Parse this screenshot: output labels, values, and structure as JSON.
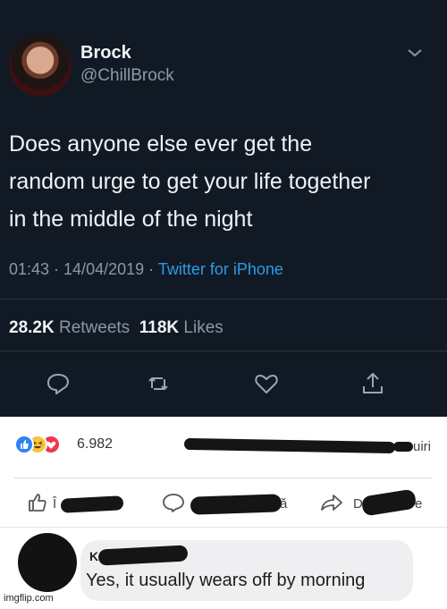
{
  "tweet": {
    "name": "Brock",
    "handle": "@ChillBrock",
    "text_lines": [
      "Does anyone else ever get the",
      "random urge to get your life together",
      "in the middle of the night"
    ],
    "time": "01:43 · 14/04/2019 · ",
    "source": "Twitter for iPhone",
    "retweets_count": "28.2K",
    "retweets_label": "Retweets",
    "likes_count": "118K",
    "likes_label": "Likes",
    "actions": [
      "reply-icon",
      "retweet-icon",
      "like-icon",
      "share-icon"
    ],
    "colors": {
      "background": "#111a24",
      "link": "#2c9be8",
      "muted": "#8b97a2"
    }
  },
  "facebook": {
    "reactions": [
      "like-reaction-icon",
      "haha-reaction-icon",
      "love-reaction-icon"
    ],
    "reaction_count": "6.982",
    "shares_suffix": "uiri",
    "action_like_partial": "Î",
    "action_comment_partial": "ă",
    "action_share_partial": "D",
    "action_share_tail": "e",
    "comment": {
      "author_partial": "Ko",
      "text": "Yes, it usually wears off by morning"
    },
    "colors": {
      "like": "#2d82f6",
      "haha": "#f7c43a",
      "love": "#f0364f"
    }
  },
  "watermark": "imgflip.com"
}
